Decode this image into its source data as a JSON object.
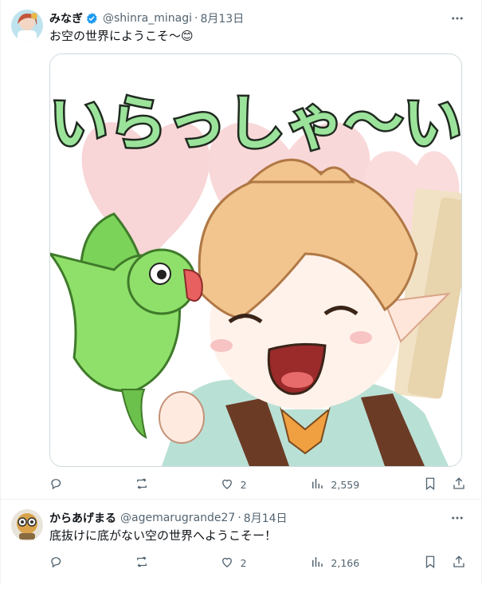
{
  "tweets": [
    {
      "name": "みなぎ",
      "handle": "@shinra_minagi",
      "separator": "·",
      "date": "8月13日",
      "text": "お空の世界にようこそ〜😊",
      "verified": true,
      "image_text": "いらっしゃ〜い",
      "replies": "",
      "retweets": "",
      "likes": "2",
      "views": "2,559"
    },
    {
      "name": "からあげまる",
      "handle": "@agemarugrande27",
      "separator": "·",
      "date": "8月14日",
      "text": "底抜けに底がない空の世界へようこそー！",
      "verified": false,
      "replies": "",
      "retweets": "",
      "likes": "2",
      "views": "2,166"
    }
  ],
  "icons": [
    "more-icon",
    "reply-icon",
    "retweet-icon",
    "like-icon",
    "views-icon",
    "bookmark-icon",
    "share-icon",
    "verified-icon"
  ],
  "colors": {
    "text": "#0f1419",
    "muted": "#536471",
    "verified": "#1d9bf0",
    "border": "#eff3f4"
  }
}
